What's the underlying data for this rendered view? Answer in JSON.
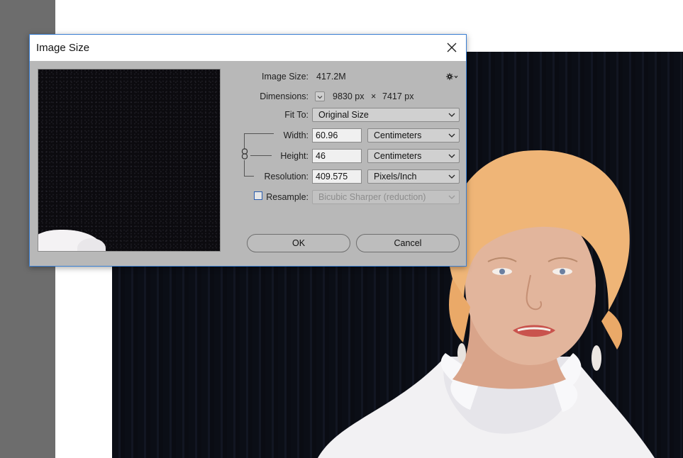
{
  "dialog": {
    "title": "Image Size",
    "image_size_label": "Image Size:",
    "image_size_value": "417.2M",
    "dimensions_label": "Dimensions:",
    "dimensions_width": "9830 px",
    "dimensions_sep": "×",
    "dimensions_height": "7417 px",
    "fit_to_label": "Fit To:",
    "fit_to_value": "Original Size",
    "width_label": "Width:",
    "width_value": "60.96",
    "width_unit": "Centimeters",
    "height_label": "Height:",
    "height_value": "46",
    "height_unit": "Centimeters",
    "resolution_label": "Resolution:",
    "resolution_value": "409.575",
    "resolution_unit": "Pixels/Inch",
    "resample_label": "Resample:",
    "resample_checked": false,
    "resample_value": "Bicubic Sharper (reduction)",
    "ok_label": "OK",
    "cancel_label": "Cancel"
  },
  "icons": {
    "close": "close-icon",
    "gear": "gear-icon",
    "chain": "chain-link-icon",
    "chevron": "chevron-down-icon"
  },
  "colors": {
    "dialog_bg": "#b8b8b8",
    "dialog_border": "#3a7fd3",
    "left_panel": "#6d6d6d",
    "photo_bg": "#0b0e16"
  }
}
